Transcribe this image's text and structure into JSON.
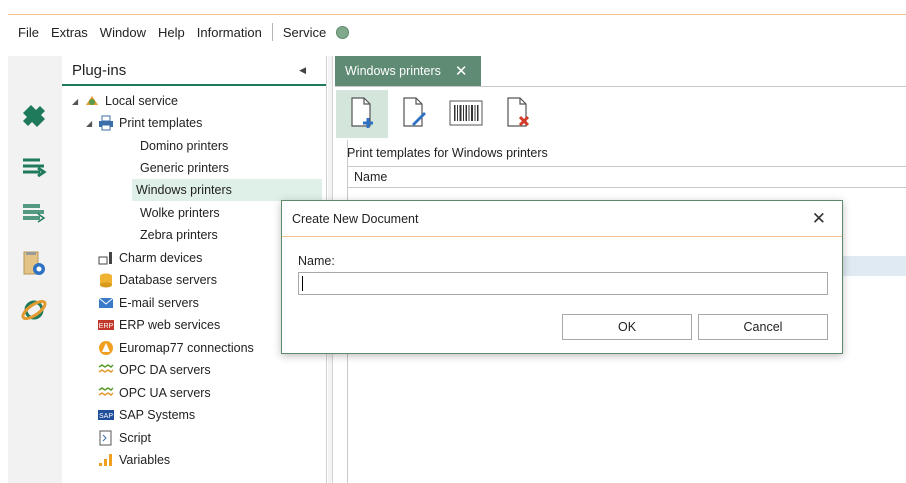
{
  "menu": {
    "items": [
      "File",
      "Extras",
      "Window",
      "Help",
      "Information"
    ],
    "service_label": "Service",
    "service_status_color": "#7fa98a"
  },
  "iconbar": {
    "icons": [
      "plugins-icon",
      "transfer-in-icon",
      "transfer-out-icon",
      "folder-settings-icon",
      "network-icon"
    ]
  },
  "panel": {
    "title": "Plug-ins",
    "collapse_icon": "triangle-left-icon",
    "tree": [
      {
        "label": "Local service",
        "icon": "service-icon",
        "level": 0,
        "expanded": true
      },
      {
        "label": "Print templates",
        "icon": "printer-icon",
        "level": 1,
        "expanded": true
      },
      {
        "label": "Domino printers",
        "level": 2
      },
      {
        "label": "Generic printers",
        "level": 2
      },
      {
        "label": "Windows printers",
        "level": 2,
        "selected": true
      },
      {
        "label": "Wolke printers",
        "level": 2
      },
      {
        "label": "Zebra printers",
        "level": 2
      },
      {
        "label": "Charm devices",
        "icon": "device-icon",
        "level": 1
      },
      {
        "label": "Database servers",
        "icon": "database-icon",
        "level": 1
      },
      {
        "label": "E-mail servers",
        "icon": "email-icon",
        "level": 1
      },
      {
        "label": "ERP web services",
        "icon": "erp-icon",
        "level": 1
      },
      {
        "label": "Euromap77 connections",
        "icon": "euromap-icon",
        "level": 1
      },
      {
        "label": "OPC DA servers",
        "icon": "opc-icon",
        "level": 1
      },
      {
        "label": "OPC UA servers",
        "icon": "opc-icon",
        "level": 1
      },
      {
        "label": "SAP Systems",
        "icon": "sap-icon",
        "level": 1
      },
      {
        "label": "Script",
        "icon": "script-icon",
        "level": 1
      },
      {
        "label": "Variables",
        "icon": "variables-icon",
        "level": 1
      }
    ]
  },
  "doc": {
    "tab_label": "Windows printers",
    "tab_close": "✕",
    "toolbar": [
      "new-document-icon",
      "edit-document-icon",
      "barcode-icon",
      "delete-document-icon"
    ],
    "list_title": "Print templates for Windows printers",
    "column_name": "Name"
  },
  "dialog": {
    "title": "Create New Document",
    "close": "✕",
    "name_label": "Name:",
    "name_value": "",
    "ok_label": "OK",
    "cancel_label": "Cancel"
  },
  "colors": {
    "accent_green": "#1e7a5a",
    "tab_green": "#5f8b74",
    "selection": "#dff0e8",
    "orange_accent": "#f2c191"
  }
}
